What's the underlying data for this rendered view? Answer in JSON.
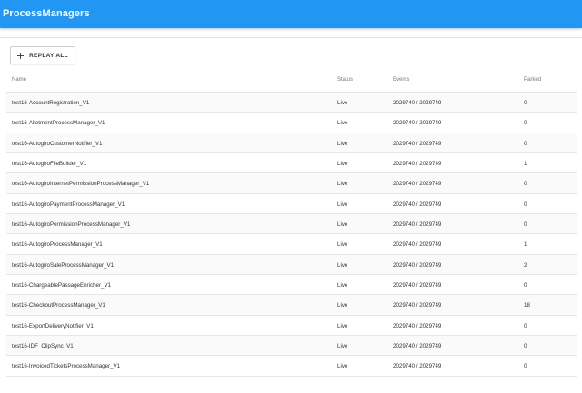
{
  "app": {
    "title": "ProcessManagers"
  },
  "toolbar": {
    "replay_all_label": "REPLAY ALL"
  },
  "table": {
    "headers": {
      "name": "Name",
      "status": "Status",
      "events": "Events",
      "parked": "Parked"
    },
    "rows": [
      {
        "name": "test16-AccountRegistration_V1",
        "status": "Live",
        "events": "2029740 / 2029749",
        "parked": "0"
      },
      {
        "name": "test16-AllotmentProcessManager_V1",
        "status": "Live",
        "events": "2029740 / 2029749",
        "parked": "0"
      },
      {
        "name": "test16-AutogiroCustomerNotifier_V1",
        "status": "Live",
        "events": "2029740 / 2029749",
        "parked": "0"
      },
      {
        "name": "test16-AutogiroFileBuilder_V1",
        "status": "Live",
        "events": "2029740 / 2029749",
        "parked": "1"
      },
      {
        "name": "test16-AutogiroInternetPermissionProcessManager_V1",
        "status": "Live",
        "events": "2029740 / 2029749",
        "parked": "0"
      },
      {
        "name": "test16-AutogiroPaymentProcessManager_V1",
        "status": "Live",
        "events": "2029740 / 2029749",
        "parked": "0"
      },
      {
        "name": "test16-AutogiroPermissionProcessManager_V1",
        "status": "Live",
        "events": "2029740 / 2029749",
        "parked": "0"
      },
      {
        "name": "test16-AutogiroProcessManager_V1",
        "status": "Live",
        "events": "2029740 / 2029749",
        "parked": "1"
      },
      {
        "name": "test16-AutogiroSaleProcessManager_V1",
        "status": "Live",
        "events": "2029740 / 2029749",
        "parked": "2"
      },
      {
        "name": "test16-ChargeablePassageEnricher_V1",
        "status": "Live",
        "events": "2029740 / 2029749",
        "parked": "0"
      },
      {
        "name": "test16-CheckoutProcessManager_V1",
        "status": "Live",
        "events": "2029740 / 2029749",
        "parked": "18"
      },
      {
        "name": "test16-ExportDeliveryNotifier_V1",
        "status": "Live",
        "events": "2029740 / 2029749",
        "parked": "0"
      },
      {
        "name": "test16-IDF_ClipSync_V1",
        "status": "Live",
        "events": "2029740 / 2029749",
        "parked": "0"
      },
      {
        "name": "test16-InvoicedTicketsProcessManager_V1",
        "status": "Live",
        "events": "2029740 / 2029749",
        "parked": "0"
      }
    ]
  }
}
